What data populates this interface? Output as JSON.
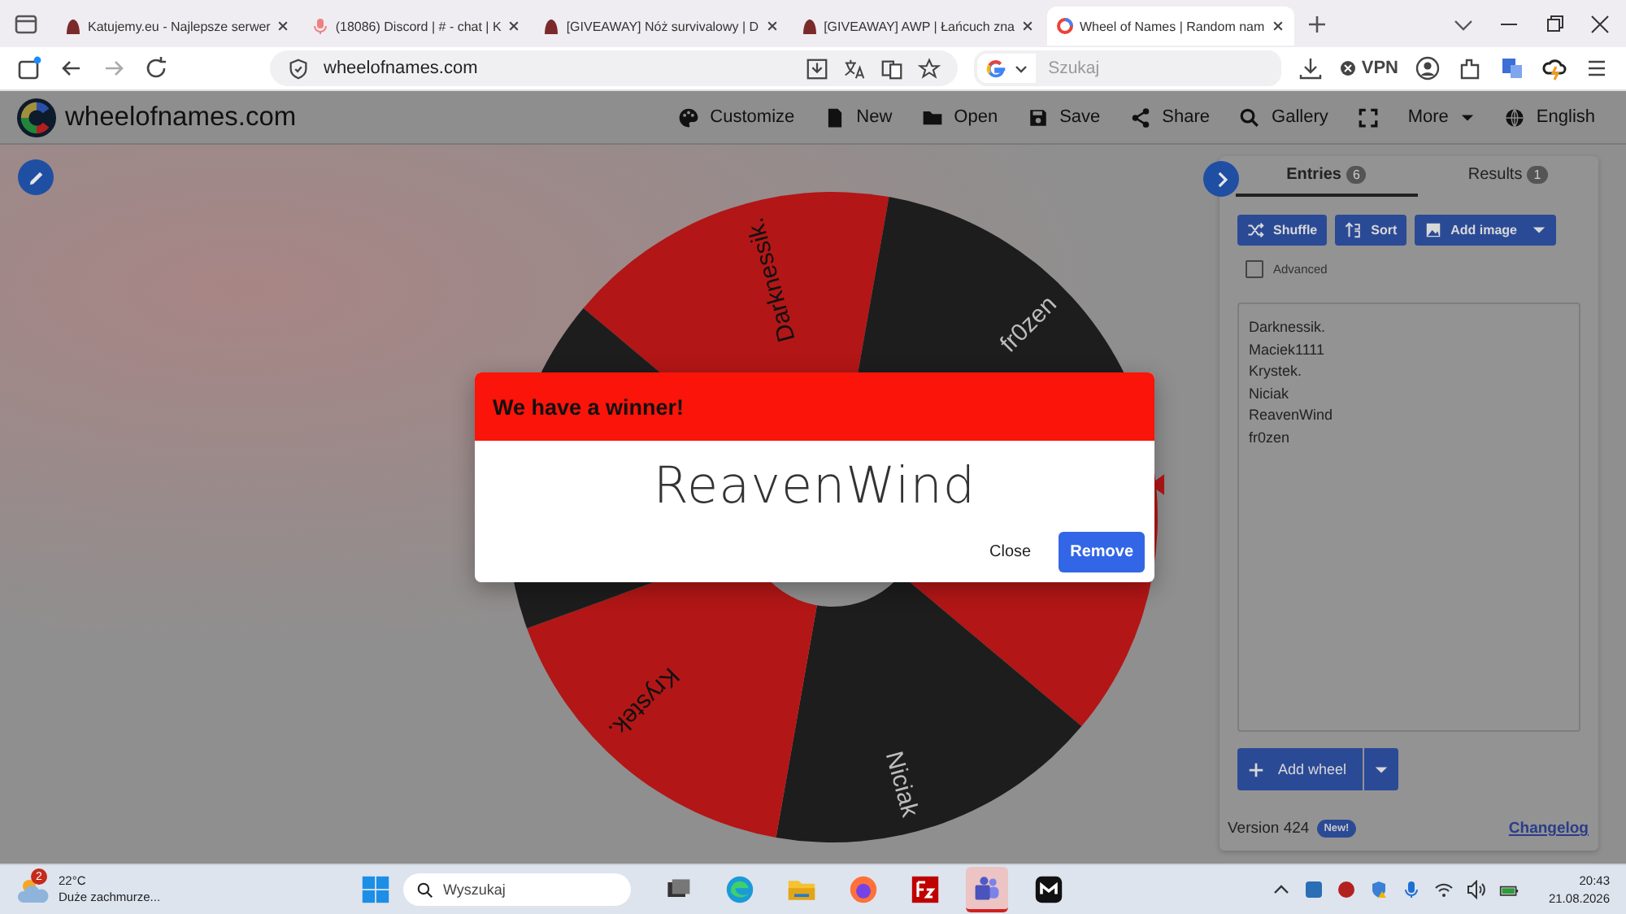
{
  "browser": {
    "tabs": [
      {
        "title": "Katujemy.eu - Najlepsze serwer",
        "selected": false
      },
      {
        "title": "(18086) Discord | # - chat | K",
        "selected": false
      },
      {
        "title": "[GIVEAWAY] Nóż survivalowy | D",
        "selected": false
      },
      {
        "title": "[GIVEAWAY] AWP | Łańcuch zna",
        "selected": false
      },
      {
        "title": "Wheel of Names | Random nam",
        "selected": true
      }
    ],
    "address": "wheelofnames.com",
    "search_placeholder": "Szukaj",
    "vpn": "VPN"
  },
  "header": {
    "logo": "wheelofnames.com",
    "menu": [
      "Customize",
      "New",
      "Open",
      "Save",
      "Share",
      "Gallery",
      "More",
      "English"
    ]
  },
  "wheel": {
    "segments": [
      {
        "name": "Darknessik.",
        "color": "#b31616"
      },
      {
        "name": "fr0zen",
        "color": "#1d1d1d"
      },
      {
        "color": "#b31616"
      },
      {
        "name": "Niciak",
        "color": "#1d1d1d"
      },
      {
        "name": "Krystek.",
        "color": "#b31616"
      },
      {
        "color": "#1d1d1d"
      }
    ]
  },
  "sidebar": {
    "tabs": [
      {
        "label": "Entries",
        "count": "6",
        "selected": true
      },
      {
        "label": "Results",
        "count": "1",
        "selected": false
      }
    ],
    "buttons": [
      "Shuffle",
      "Sort",
      "Add image"
    ],
    "advanced": {
      "label": "Advanced",
      "checked": false
    },
    "entries": [
      "Darknessik.",
      "Maciek1111",
      "Krystek.",
      "Niciak",
      "ReavenWind",
      "fr0zen"
    ],
    "add_wheel": "Add wheel",
    "version": "Version 424",
    "new_badge": "New!",
    "changelog": "Changelog"
  },
  "dialog": {
    "title": "We have a winner!",
    "winner": "ReavenWind",
    "buttons": [
      "Close",
      "Remove"
    ]
  },
  "taskbar": {
    "weather": {
      "temp": "22°C",
      "text": "Duże zachmurze...",
      "badge": "2"
    },
    "search": "Wyszukaj",
    "time": "20:43",
    "date": "21.08.2026"
  }
}
